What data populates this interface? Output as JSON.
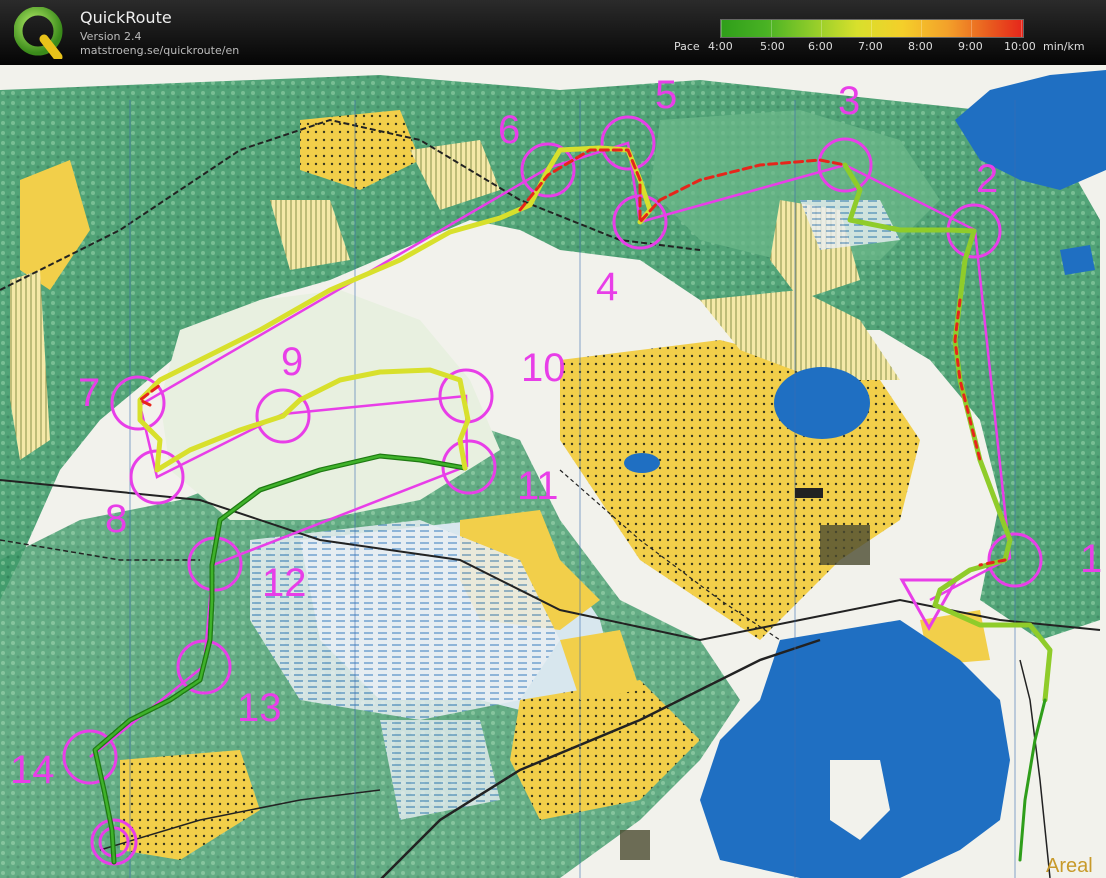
{
  "app": {
    "title": "QuickRoute",
    "version": "Version 2.4",
    "url": "matstroeng.se/quickroute/en",
    "logo_letter": "Q"
  },
  "pace_scale": {
    "label": "Pace",
    "ticks": [
      "4:00",
      "5:00",
      "6:00",
      "7:00",
      "8:00",
      "9:00",
      "10:00"
    ],
    "unit": "min/km",
    "colors": [
      "#2f9e1a",
      "#8fcc2a",
      "#d8e02c",
      "#f4cf2a",
      "#f3a12a",
      "#e8561e",
      "#e6251b"
    ]
  },
  "map": {
    "controls": [
      {
        "number": "1"
      },
      {
        "number": "2"
      },
      {
        "number": "3"
      },
      {
        "number": "4"
      },
      {
        "number": "5"
      },
      {
        "number": "6"
      },
      {
        "number": "7"
      },
      {
        "number": "8"
      },
      {
        "number": "9"
      },
      {
        "number": "10"
      },
      {
        "number": "11"
      },
      {
        "number": "12"
      },
      {
        "number": "13"
      },
      {
        "number": "14"
      }
    ],
    "corner_text": "Areal",
    "overprint_color": "#e83ee8",
    "route_colors": {
      "fast": "#2f9e1a",
      "medium": "#d8e02c",
      "slow": "#e6251b"
    }
  }
}
